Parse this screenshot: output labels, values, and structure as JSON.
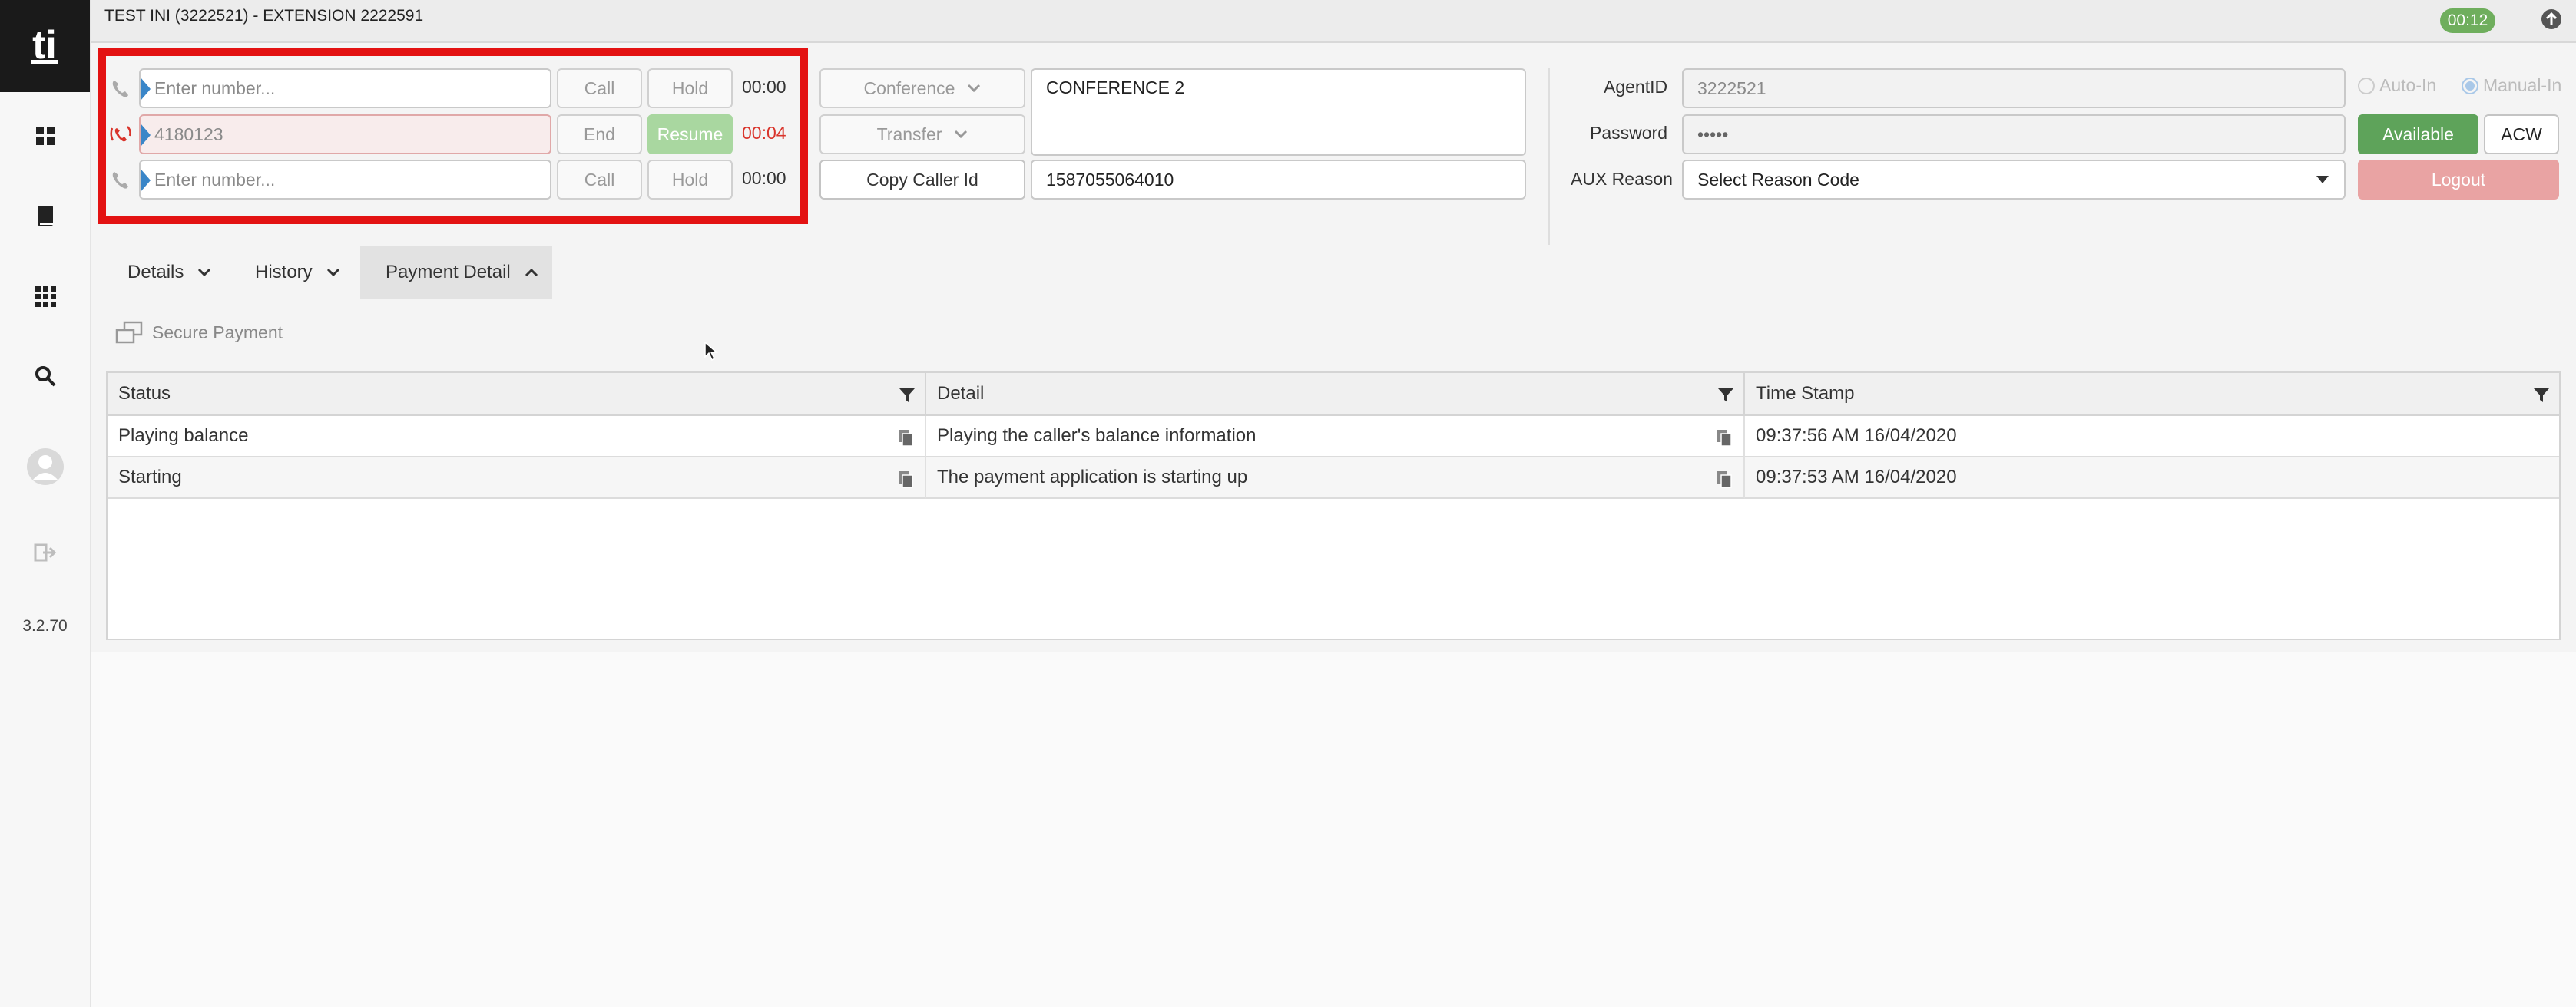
{
  "header": {
    "title": "TEST INI (3222521) - EXTENSION 2222591",
    "call_timer": "00:12"
  },
  "sidebar": {
    "version": "3.2.70"
  },
  "lines": [
    {
      "placeholder": "Enter number...",
      "value": "",
      "action": "Call",
      "hold": "Hold",
      "time": "00:00"
    },
    {
      "placeholder": "",
      "value": "4180123",
      "action": "End",
      "hold": "Resume",
      "time": "00:04"
    },
    {
      "placeholder": "Enter number...",
      "value": "",
      "action": "Call",
      "hold": "Hold",
      "time": "00:00"
    }
  ],
  "mid": {
    "conference_label": "Conference",
    "transfer_label": "Transfer",
    "copy_caller_label": "Copy Caller Id",
    "conference_note": "CONFERENCE 2",
    "caller_id": "1587055064010"
  },
  "agent": {
    "agent_id_label": "AgentID",
    "agent_id": "3222521",
    "password_label": "Password",
    "password": "•••••",
    "aux_label": "AUX Reason",
    "aux_value": "Select Reason Code",
    "auto_in": "Auto-In",
    "manual_in": "Manual-In",
    "available": "Available",
    "acw": "ACW",
    "logout": "Logout"
  },
  "tabs": [
    {
      "label": "Details"
    },
    {
      "label": "History"
    },
    {
      "label": "Payment Detail"
    }
  ],
  "secure_payment": "Secure Payment",
  "table": {
    "columns": [
      "Status",
      "Detail",
      "Time Stamp"
    ],
    "rows": [
      [
        "Playing balance",
        "Playing the caller's balance information",
        "09:37:56 AM 16/04/2020"
      ],
      [
        "Starting",
        "The payment application is starting up",
        "09:37:53 AM 16/04/2020"
      ]
    ]
  },
  "colors": {
    "accent_red": "#e31212",
    "green": "#5ea35a",
    "logout_red": "#e9a3a3"
  }
}
